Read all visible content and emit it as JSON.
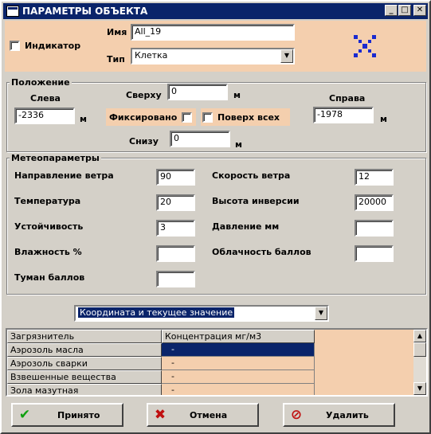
{
  "window": {
    "title": "ПАРАМЕТРЫ ОБЪЕКТА",
    "min": "_",
    "max": "□",
    "close": "✕"
  },
  "object": {
    "indicator_label": "Индикатор",
    "name_label": "Имя",
    "name_value": "All_19",
    "type_label": "Тип",
    "type_value": "Клетка"
  },
  "position": {
    "group_label": "Положение",
    "left_label": "Слева",
    "left_value": "-2336",
    "left_unit": "м",
    "top_label": "Сверху",
    "top_value": "0",
    "top_unit": "м",
    "right_label": "Справа",
    "right_value": "-1978",
    "right_unit": "м",
    "bottom_label": "Снизу",
    "bottom_value": "0",
    "bottom_unit": "м",
    "fixed_label": "Фиксировано",
    "ontop_label": "Поверх всех"
  },
  "meteo": {
    "group_label": "Метеопараметры",
    "wind_dir_label": "Направление ветра",
    "wind_dir_value": "90",
    "wind_speed_label": "Скорость ветра",
    "wind_speed_value": "12",
    "temp_label": "Температура",
    "temp_value": "20",
    "inversion_label": "Высота инверсии",
    "inversion_value": "20000",
    "stability_label": "Устойчивость",
    "stability_value": "3",
    "pressure_label": "Давление мм",
    "pressure_value": "",
    "humidity_label": "Влажность %",
    "humidity_value": "",
    "cloud_label": "Облачность баллов",
    "cloud_value": "",
    "fog_label": "Туман баллов",
    "fog_value": ""
  },
  "mode_select": {
    "value": "Координата и текущее значение"
  },
  "table": {
    "headers": [
      "Загрязнитель",
      "Концентрация мг/м3"
    ],
    "rows": [
      {
        "pollutant": "Аэрозоль масла",
        "value": "-"
      },
      {
        "pollutant": "Аэрозоль сварки",
        "value": "-"
      },
      {
        "pollutant": "Взвешенные вещества",
        "value": "-"
      },
      {
        "pollutant": "Зола мазутная",
        "value": "-"
      }
    ]
  },
  "buttons": {
    "ok": "Принято",
    "cancel": "Отмена",
    "delete": "Удалить"
  },
  "colors": {
    "panel": "#f4cfae",
    "title": "#0a246a",
    "face": "#d4d0c8"
  }
}
